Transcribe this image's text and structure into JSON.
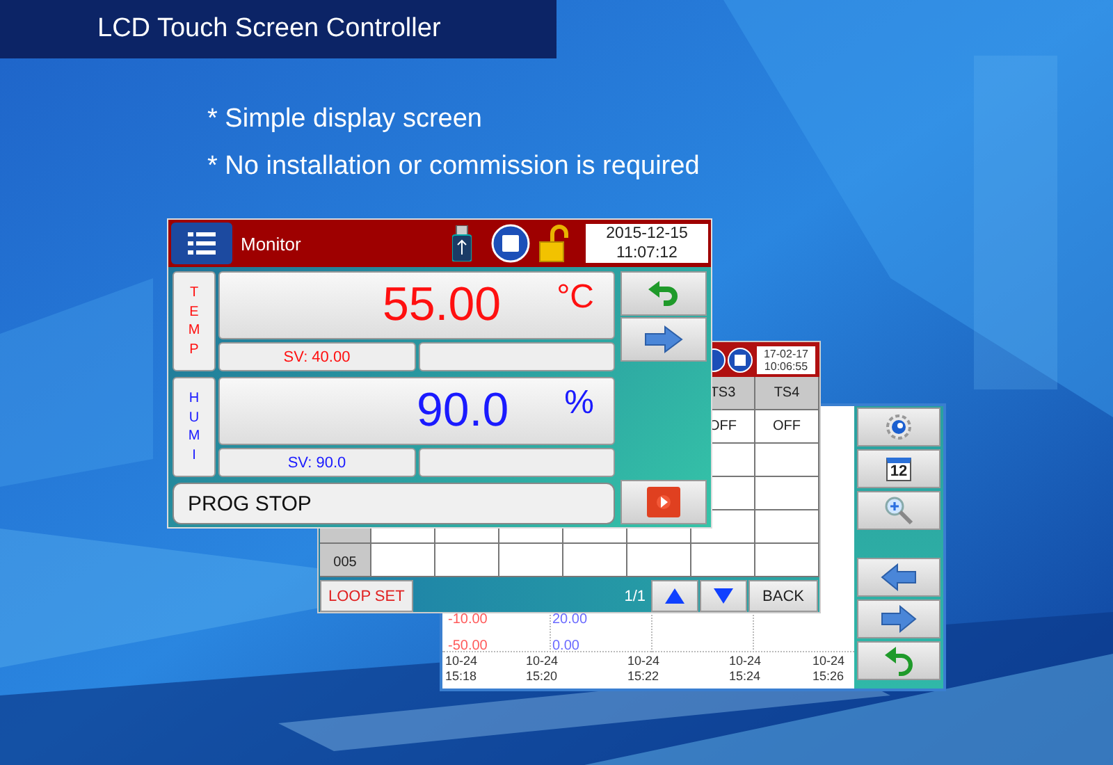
{
  "banner": {
    "title": "LCD Touch Screen Controller"
  },
  "features": [
    "* Simple display screen",
    "* No installation or commission is required"
  ],
  "trend_screen": {
    "axis_labels": [
      {
        "text": "-10.00",
        "color": "#ff5a5a"
      },
      {
        "text": "20.00",
        "color": "#6a6aff"
      },
      {
        "text": "-50.00",
        "color": "#ff5a5a"
      },
      {
        "text": "0.00",
        "color": "#6a6aff"
      }
    ],
    "x_labels": [
      {
        "date": "10-24",
        "time": "15:18"
      },
      {
        "date": "10-24",
        "time": "15:20"
      },
      {
        "date": "10-24",
        "time": "15:22"
      },
      {
        "date": "10-24",
        "time": "15:24"
      },
      {
        "date": "10-24",
        "time": "15:26"
      }
    ],
    "side_buttons": [
      {
        "kind": "settings"
      },
      {
        "kind": "calendar",
        "text": "12"
      },
      {
        "kind": "zoom"
      },
      {
        "kind": "spacer"
      },
      {
        "kind": "left"
      },
      {
        "kind": "right"
      },
      {
        "kind": "return"
      }
    ]
  },
  "loop_screen": {
    "date": "17-02-17",
    "time": "10:06:55",
    "columns": [
      "TS3",
      "TS4"
    ],
    "rows": [
      {
        "cells": [
          "OFF",
          "OFF"
        ]
      },
      {},
      {},
      {},
      {
        "label": "005"
      }
    ],
    "loop_set": "LOOP SET",
    "page": "1/1",
    "back": "BACK"
  },
  "monitor_screen": {
    "title": "Monitor",
    "date": "2015-12-15",
    "time": "11:07:12",
    "channels": [
      {
        "letters": "TEMP",
        "value": "55.00",
        "unit": "°C",
        "sv": "SV: 40.00",
        "color": "#ff1010"
      },
      {
        "letters": "HUMI",
        "value": "90.0",
        "unit": "%",
        "sv": "SV: 90.0",
        "color": "#1a1aff"
      }
    ],
    "status": "PROG STOP"
  }
}
